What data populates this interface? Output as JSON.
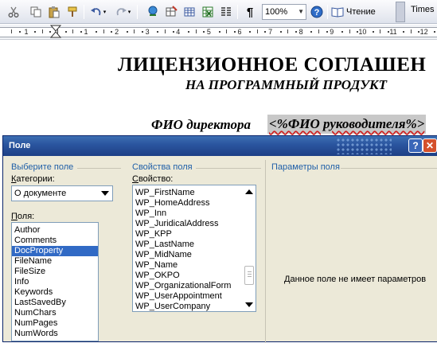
{
  "toolbar": {
    "icons": [
      "cut-icon",
      "copy-icon",
      "paste-icon",
      "format-painter-icon",
      "undo-icon",
      "redo-icon",
      "hyperlink-icon",
      "tables-borders-icon",
      "insert-table-icon",
      "insert-excel-icon",
      "columns-icon",
      "show-formatting-icon",
      "help-icon",
      "read-icon"
    ],
    "show_formatting_symbol": "¶",
    "zoom_value": "100%",
    "read_label": "Чтение",
    "font_name": "Times"
  },
  "ruler": {
    "numbers": [
      "1",
      "1",
      "2",
      "3",
      "4",
      "5",
      "6",
      "7",
      "8",
      "9",
      "10",
      "11",
      "12"
    ]
  },
  "document": {
    "title": "ЛИЦЕНЗИОННОЕ СОГЛАШЕН",
    "subtitle": "НА ПРОГРАММНЫЙ ПРОДУКТ",
    "director_label": "ФИО директора",
    "director_field": "<%ФИО руководителя%>"
  },
  "dialog": {
    "title": "Поле",
    "help_symbol": "?",
    "close_symbol": "✕",
    "select_field_group": "Выберите поле",
    "categories_label_underlined": "К",
    "categories_label_rest": "атегории:",
    "category_value": "О документе",
    "fields_label_underlined": "П",
    "fields_label_rest": "оля:",
    "fields": [
      "Author",
      "Comments",
      "DocProperty",
      "FileName",
      "FileSize",
      "Info",
      "Keywords",
      "LastSavedBy",
      "NumChars",
      "NumPages",
      "NumWords"
    ],
    "selected_field": "DocProperty",
    "properties_group": "Свойства поля",
    "property_label_underlined": "С",
    "property_label_rest": "войство:",
    "properties": [
      "WP_FirstName",
      "WP_HomeAddress",
      "WP_Inn",
      "WP_JuridicalAddress",
      "WP_KPP",
      "WP_LastName",
      "WP_MidName",
      "WP_Name",
      "WP_OKPO",
      "WP_OrganizationalForm",
      "WP_UserAppointment",
      "WP_UserCompany"
    ],
    "params_group": "Параметры поля",
    "no_params_text": "Данное поле не имеет параметров"
  },
  "colors": {
    "titlebar": "#2b56a0",
    "dialog_bg": "#ece9d8",
    "group_heading": "#1f5fa8",
    "selection": "#316ac5",
    "field_shading": "#c8c8c8"
  }
}
